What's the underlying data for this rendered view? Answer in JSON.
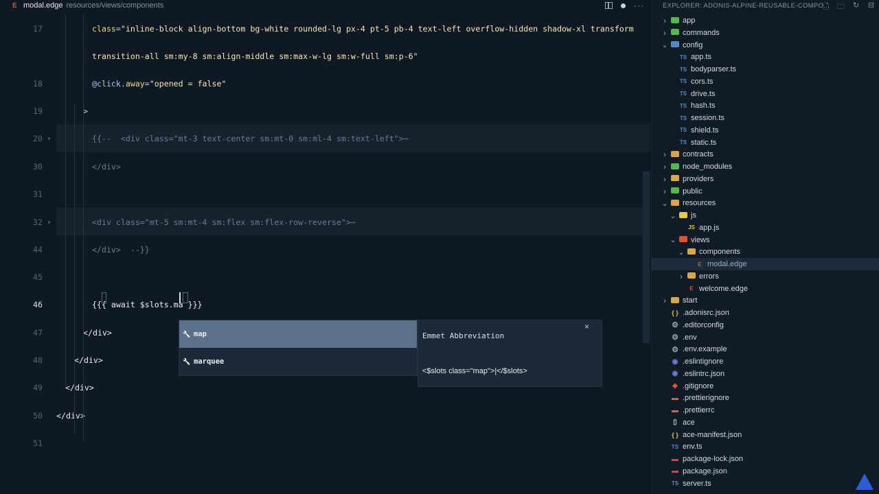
{
  "tab": {
    "icon": "E",
    "file": "modal.edge",
    "path": "resources/views/components"
  },
  "editor_lines": [
    {
      "n": "17",
      "parts": [
        [
          "class",
          "t-attr"
        ],
        [
          "=",
          "t-punct"
        ],
        [
          "\"inline-block align-bottom bg-white rounded-lg px-4 pt-5 pb-4 text-left overflow-hidden shadow-xl transform",
          "t-str"
        ]
      ]
    },
    {
      "n": "",
      "parts": [
        [
          "transition-all sm:my-8 sm:align-middle sm:max-w-lg sm:w-full sm:p-6\"",
          "t-str"
        ]
      ]
    },
    {
      "n": "18",
      "parts": [
        [
          "@click",
          "t-ev"
        ],
        [
          ".away",
          "t-attr"
        ],
        [
          "=",
          "t-punct"
        ],
        [
          "\"opened = false\"",
          "t-str"
        ]
      ]
    },
    {
      "n": "19",
      "parts": [
        [
          ">",
          "t-punct"
        ]
      ]
    },
    {
      "n": "20",
      "parts": [
        [
          "{{--  <div class=\"mt-3 text-center sm:mt-0 sm:ml-4 sm:text-left\">⋯",
          "t-dim"
        ]
      ]
    },
    {
      "n": "30",
      "parts": [
        [
          "</div>",
          "t-dim"
        ]
      ]
    },
    {
      "n": "31",
      "parts": []
    },
    {
      "n": "32",
      "parts": [
        [
          "<div class=\"mt-5 sm:mt-4 sm:flex sm:flex-row-reverse\">⋯",
          "t-dim"
        ]
      ]
    },
    {
      "n": "44",
      "parts": [
        [
          "</div>  --}}",
          "t-dim"
        ]
      ]
    },
    {
      "n": "45",
      "parts": []
    },
    {
      "n": "46",
      "parts": [
        [
          "{{{ await $slots.ma }}}",
          "t-tag"
        ]
      ]
    },
    {
      "n": "47",
      "parts": [
        [
          "</div>",
          "t-tag"
        ]
      ]
    },
    {
      "n": "48",
      "parts": [
        [
          "</div>",
          "t-tag"
        ]
      ]
    },
    {
      "n": "49",
      "parts": [
        [
          "</div>",
          "t-tag"
        ]
      ]
    },
    {
      "n": "50",
      "parts": [
        [
          "</div>",
          "t-tag"
        ]
      ]
    },
    {
      "n": "51",
      "parts": []
    }
  ],
  "suggest": {
    "items": [
      {
        "icon": "wrench-icon",
        "label": "map"
      },
      {
        "icon": "wrench-icon",
        "label": "marquee"
      }
    ],
    "details_title": "Emmet Abbreviation",
    "details_body": "<$slots class=\"map\">|</$slots>",
    "close_glyph": "×"
  },
  "explorer": {
    "title": "EXPLORER: ADONIS-ALPINE-REUSABLE-COMPO...",
    "tree": [
      {
        "label": "app",
        "depth": 0,
        "type": "folder",
        "open": false,
        "color": "#55b84a"
      },
      {
        "label": "commands",
        "depth": 0,
        "type": "folder",
        "open": false,
        "color": "#55b84a"
      },
      {
        "label": "config",
        "depth": 0,
        "type": "folder",
        "open": true,
        "color": "#4f8bc9"
      },
      {
        "label": "app.ts",
        "depth": 1,
        "type": "ts"
      },
      {
        "label": "bodyparser.ts",
        "depth": 1,
        "type": "ts"
      },
      {
        "label": "cors.ts",
        "depth": 1,
        "type": "ts"
      },
      {
        "label": "drive.ts",
        "depth": 1,
        "type": "ts"
      },
      {
        "label": "hash.ts",
        "depth": 1,
        "type": "ts"
      },
      {
        "label": "session.ts",
        "depth": 1,
        "type": "ts"
      },
      {
        "label": "shield.ts",
        "depth": 1,
        "type": "ts"
      },
      {
        "label": "static.ts",
        "depth": 1,
        "type": "ts"
      },
      {
        "label": "contracts",
        "depth": 0,
        "type": "folder",
        "open": false,
        "color": "#d9a642"
      },
      {
        "label": "node_modules",
        "depth": 0,
        "type": "folder",
        "open": false,
        "color": "#55b84a"
      },
      {
        "label": "providers",
        "depth": 0,
        "type": "folder",
        "open": false,
        "color": "#d9a642"
      },
      {
        "label": "public",
        "depth": 0,
        "type": "folder",
        "open": false,
        "color": "#55b84a"
      },
      {
        "label": "resources",
        "depth": 0,
        "type": "folder",
        "open": true,
        "color": "#d9a642"
      },
      {
        "label": "js",
        "depth": 1,
        "type": "folder",
        "open": true,
        "color": "#e6c94a"
      },
      {
        "label": "app.js",
        "depth": 2,
        "type": "js"
      },
      {
        "label": "views",
        "depth": 1,
        "type": "folder",
        "open": true,
        "color": "#e0513d"
      },
      {
        "label": "components",
        "depth": 2,
        "type": "folder",
        "open": true,
        "color": "#d9a642"
      },
      {
        "label": "modal.edge",
        "depth": 3,
        "type": "edge",
        "selected": true
      },
      {
        "label": "errors",
        "depth": 2,
        "type": "folder",
        "open": false,
        "color": "#d9a642"
      },
      {
        "label": "welcome.edge",
        "depth": 2,
        "type": "edge"
      },
      {
        "label": "start",
        "depth": 0,
        "type": "folder",
        "open": false,
        "color": "#d9a642"
      },
      {
        "label": ".adonisrc.json",
        "depth": 0,
        "type": "json"
      },
      {
        "label": ".editorconfig",
        "depth": 0,
        "type": "gear"
      },
      {
        "label": ".env",
        "depth": 0,
        "type": "gear"
      },
      {
        "label": ".env.example",
        "depth": 0,
        "type": "gear"
      },
      {
        "label": ".eslintignore",
        "depth": 0,
        "type": "circle"
      },
      {
        "label": ".eslintrc.json",
        "depth": 0,
        "type": "circle"
      },
      {
        "label": ".gitignore",
        "depth": 0,
        "type": "git"
      },
      {
        "label": ".prettierignore",
        "depth": 0,
        "type": "prettier"
      },
      {
        "label": ".prettierrc",
        "depth": 0,
        "type": "prettier"
      },
      {
        "label": "ace",
        "depth": 0,
        "type": "file"
      },
      {
        "label": "ace-manifest.json",
        "depth": 0,
        "type": "json"
      },
      {
        "label": "env.ts",
        "depth": 0,
        "type": "ts"
      },
      {
        "label": "package-lock.json",
        "depth": 0,
        "type": "lock"
      },
      {
        "label": "package.json",
        "depth": 0,
        "type": "lock"
      },
      {
        "label": "server.ts",
        "depth": 0,
        "type": "ts"
      }
    ]
  }
}
